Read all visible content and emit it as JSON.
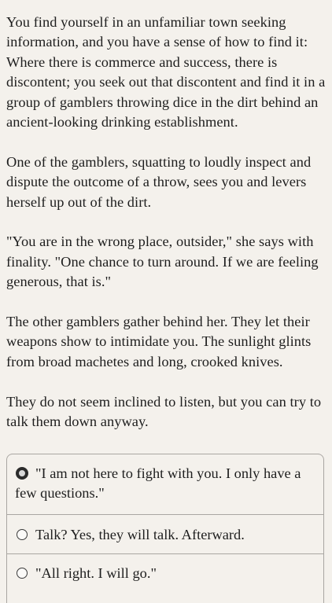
{
  "story": {
    "paragraphs": [
      "You find yourself in an unfamiliar town seeking information, and you have a sense of how to find it: Where there is commerce and success, there is discontent; you seek out that discontent and find it in a group of gamblers throwing dice in the dirt behind an ancient-looking drinking establishment.",
      "One of the gamblers, squatting to loudly inspect and dispute the outcome of a throw, sees you and levers herself up out of the dirt.",
      "\"You are in the wrong place, outsider,\" she says with finality. \"One chance to turn around. If we are feeling generous, that is.\"",
      "The other gamblers gather behind her. They let their weapons show to intimidate you. The sunlight glints from broad machetes and long, crooked knives.",
      "They do not seem inclined to listen, but you can try to talk them down anyway."
    ]
  },
  "choices": [
    {
      "label": "\"I am not here to fight with you. I only have a few questions.\"",
      "selected": true,
      "icon": "radio-selected-icon"
    },
    {
      "label": "Talk? Yes, they will talk. Afterward.",
      "selected": false,
      "icon": "radio-empty-icon"
    },
    {
      "label": "\"All right. I will go.\"",
      "selected": false,
      "icon": "radio-empty-icon"
    }
  ]
}
